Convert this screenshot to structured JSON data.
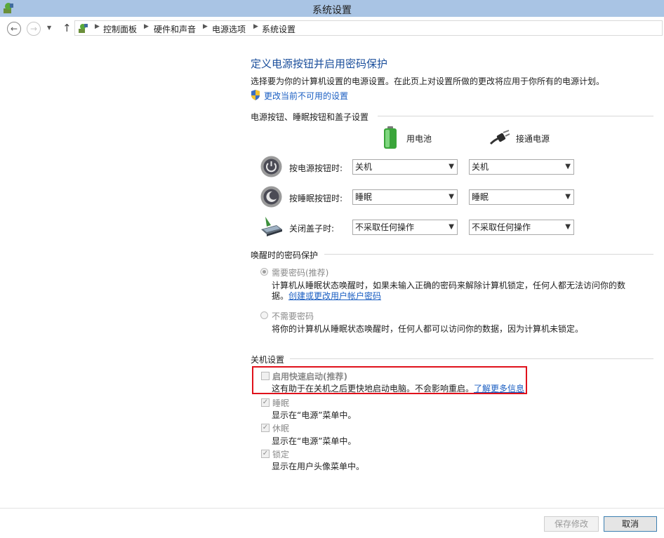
{
  "window": {
    "title": "系统设置"
  },
  "nav": {
    "back_icon": "back-arrow-icon",
    "forward_icon": "forward-arrow-icon",
    "recent_icon": "chevron-down-icon",
    "up_icon": "up-arrow-icon",
    "breadcrumb": [
      "控制面板",
      "硬件和声音",
      "电源选项",
      "系统设置"
    ]
  },
  "header": {
    "title": "定义电源按钮并启用密码保护",
    "description": "选择要为你的计算机设置的电源设置。在此页上对设置所做的更改将应用于你所有的电源计划。",
    "change_link": "更改当前不可用的设置"
  },
  "power_buttons": {
    "section_title": "电源按钮、睡眠按钮和盖子设置",
    "col_battery": "用电池",
    "col_plugged": "接通电源",
    "rows": [
      {
        "label": "按电源按钮时:",
        "battery": "关机",
        "plugged": "关机",
        "icon": "power-button-icon"
      },
      {
        "label": "按睡眠按钮时:",
        "battery": "睡眠",
        "plugged": "睡眠",
        "icon": "sleep-button-icon"
      },
      {
        "label": "关闭盖子时:",
        "battery": "不采取任何操作",
        "plugged": "不采取任何操作",
        "icon": "laptop-lid-icon"
      }
    ]
  },
  "wake_password": {
    "section_title": "唤醒时的密码保护",
    "require_label": "需要密码(推荐)",
    "require_desc_1": "计算机从睡眠状态唤醒时，如果未输入正确的密码来解除计算机锁定，任何人都无法访问你的数",
    "require_desc_2": "据。",
    "require_link": "创建或更改用户帐户密码",
    "norequire_label": "不需要密码",
    "norequire_desc": "将你的计算机从睡眠状态唤醒时，任何人都可以访问你的数据，因为计算机未锁定。"
  },
  "shutdown": {
    "section_title": "关机设置",
    "fast_startup_label": "启用快速启动(推荐)",
    "fast_startup_desc": "这有助于在关机之后更快地启动电脑。不会影响重启。",
    "fast_startup_link": "了解更多信息",
    "sleep_label": "睡眠",
    "sleep_desc": "显示在“电源”菜单中。",
    "hibernate_label": "休眠",
    "hibernate_desc": "显示在“电源”菜单中。",
    "lock_label": "锁定",
    "lock_desc": "显示在用户头像菜单中。"
  },
  "footer": {
    "save_label": "保存修改",
    "cancel_label": "取消"
  },
  "colors": {
    "titlebar": "#a9c4e4",
    "heading": "#1b4f9c",
    "link": "#1a5ec2",
    "highlight": "#e0111b"
  }
}
